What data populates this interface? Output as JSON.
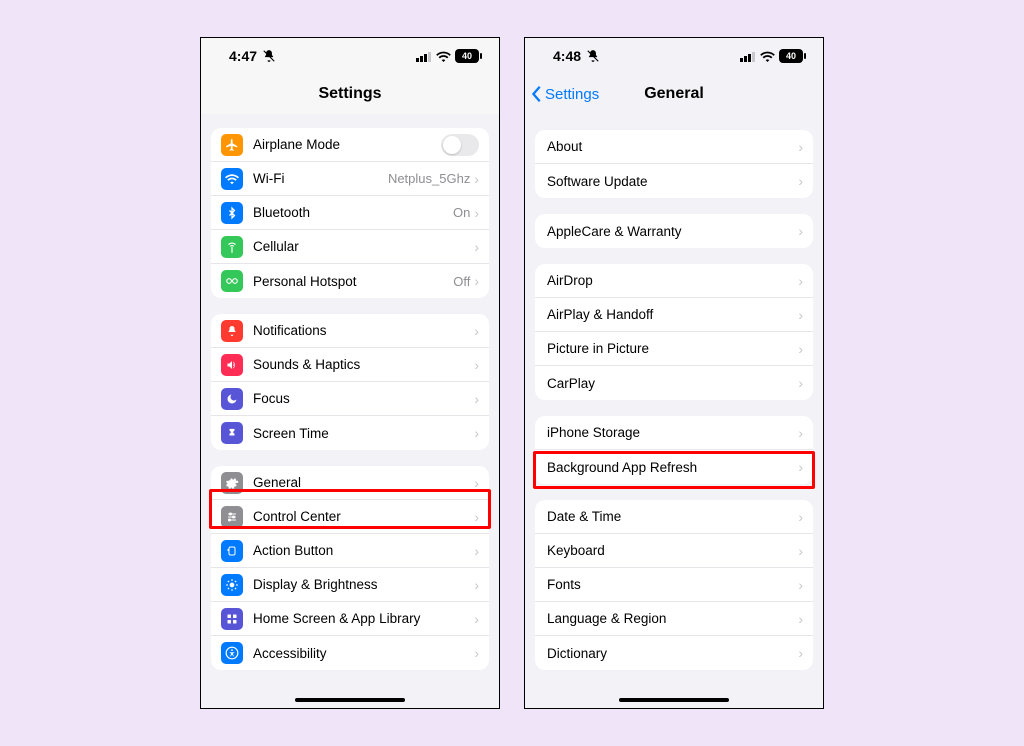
{
  "left": {
    "status": {
      "time": "4:47",
      "battery": "40"
    },
    "title": "Settings",
    "g1": [
      {
        "label": "Airplane Mode",
        "kind": "toggle"
      },
      {
        "label": "Wi-Fi",
        "value": "Netplus_5Ghz"
      },
      {
        "label": "Bluetooth",
        "value": "On"
      },
      {
        "label": "Cellular"
      },
      {
        "label": "Personal Hotspot",
        "value": "Off"
      }
    ],
    "g2": [
      {
        "label": "Notifications"
      },
      {
        "label": "Sounds & Haptics"
      },
      {
        "label": "Focus"
      },
      {
        "label": "Screen Time"
      }
    ],
    "g3": [
      {
        "label": "General"
      },
      {
        "label": "Control Center"
      },
      {
        "label": "Action Button"
      },
      {
        "label": "Display & Brightness"
      },
      {
        "label": "Home Screen & App Library"
      },
      {
        "label": "Accessibility"
      }
    ]
  },
  "right": {
    "status": {
      "time": "4:48",
      "battery": "40"
    },
    "back": "Settings",
    "title": "General",
    "g1": [
      {
        "label": "About"
      },
      {
        "label": "Software Update"
      }
    ],
    "g2": [
      {
        "label": "AppleCare & Warranty"
      }
    ],
    "g3": [
      {
        "label": "AirDrop"
      },
      {
        "label": "AirPlay & Handoff"
      },
      {
        "label": "Picture in Picture"
      },
      {
        "label": "CarPlay"
      }
    ],
    "g4": [
      {
        "label": "iPhone Storage"
      },
      {
        "label": "Background App Refresh"
      }
    ],
    "g5": [
      {
        "label": "Date & Time"
      },
      {
        "label": "Keyboard"
      },
      {
        "label": "Fonts"
      },
      {
        "label": "Language & Region"
      },
      {
        "label": "Dictionary"
      }
    ]
  }
}
